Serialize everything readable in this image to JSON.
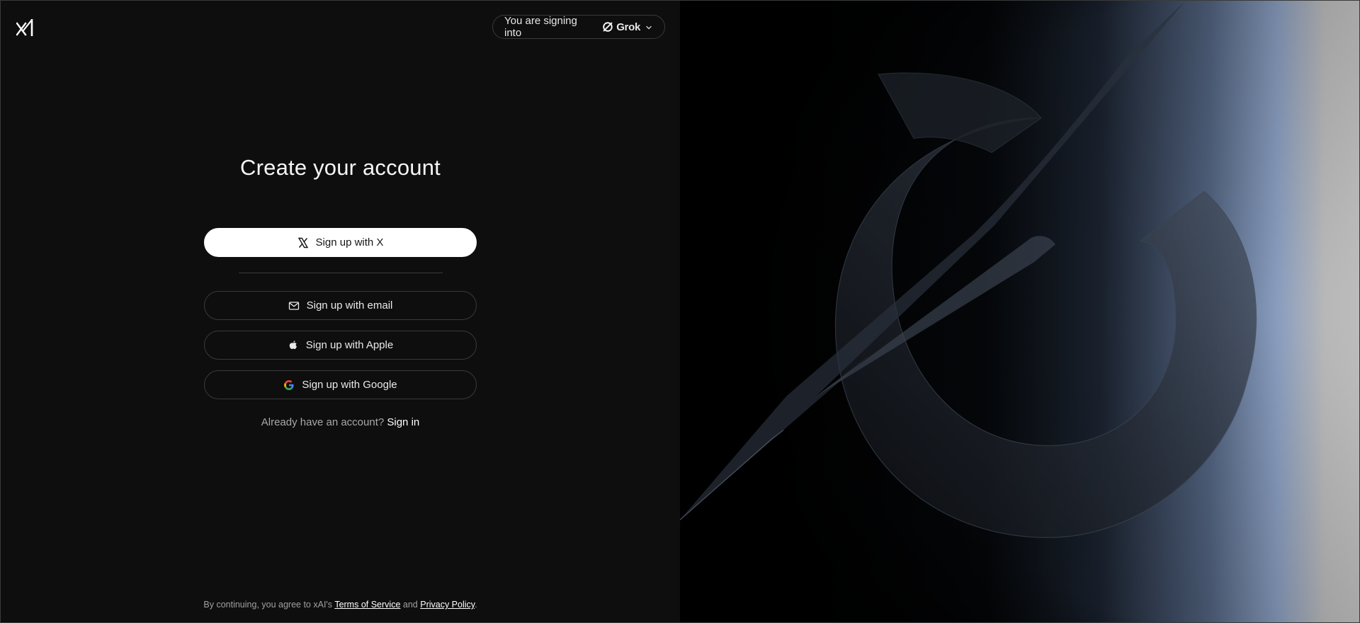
{
  "header": {
    "logo_icon": "xai-logo-icon",
    "signing_into_text": "You are signing into",
    "product_icon": "grok-icon",
    "product_name": "Grok",
    "dropdown_icon": "chevron-down-icon"
  },
  "main": {
    "title": "Create your account",
    "buttons": {
      "x": {
        "label": "Sign up with X",
        "icon": "x-logo-icon"
      },
      "email": {
        "label": "Sign up with email",
        "icon": "mail-icon"
      },
      "apple": {
        "label": "Sign up with Apple",
        "icon": "apple-icon"
      },
      "google": {
        "label": "Sign up with Google",
        "icon": "google-icon"
      }
    },
    "signin_prompt": "Already have an account?",
    "signin_link": "Sign in"
  },
  "footer": {
    "prefix": "By continuing, you agree to xAI's",
    "terms": "Terms of Service",
    "and": "and",
    "privacy": "Privacy Policy",
    "suffix": "."
  },
  "colors": {
    "background": "#0e0e0e",
    "primary_button_bg": "#ffffff",
    "border": "#3a3a3a",
    "accent_glow": "#7f95b8"
  }
}
